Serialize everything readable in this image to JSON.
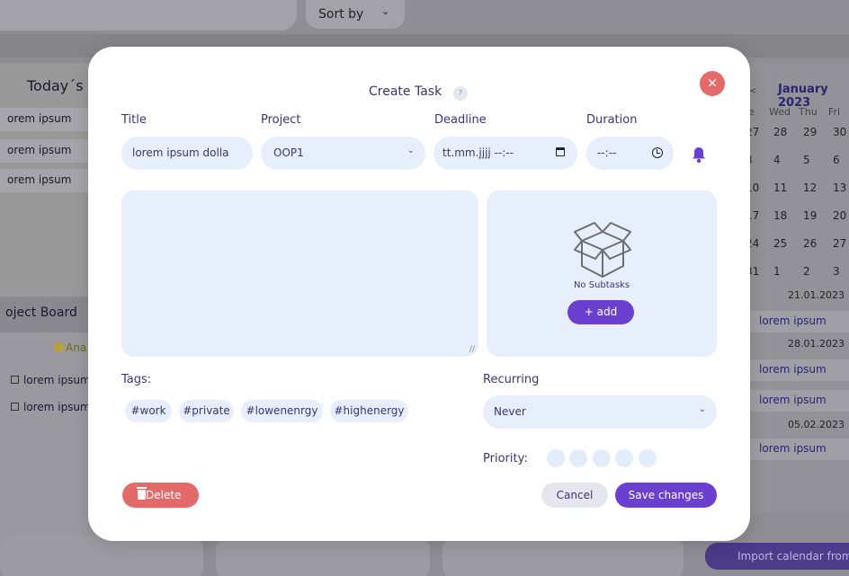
{
  "background": {
    "sort_label": "Sort by",
    "sort_chevron": "⌄",
    "todays_tasks_title": "Today´s ta",
    "todays_rows": [
      "orem ipsum",
      "orem ipsum",
      "orem ipsum"
    ],
    "project_board_title": "oject Board",
    "ana_label": "Ana",
    "project_items": [
      "lorem ipsum",
      "lorem ipsum"
    ],
    "calendar": {
      "month_title": "January 2023",
      "prev_marker": "<",
      "weekday_headers": [
        "e",
        "Wed",
        "Thu",
        "Fri"
      ],
      "weeks": [
        [
          "27",
          "28",
          "29",
          "30"
        ],
        [
          "3",
          "4",
          "5",
          "6"
        ],
        [
          "10",
          "11",
          "12",
          "13"
        ],
        [
          "17",
          "18",
          "19",
          "20"
        ],
        [
          "24",
          "25",
          "26",
          "27"
        ],
        [
          "31",
          "1",
          "2",
          "3"
        ]
      ],
      "agenda": [
        {
          "type": "date",
          "text": "21.01.2023"
        },
        {
          "type": "event",
          "marker": "9",
          "text": "lorem ipsum"
        },
        {
          "type": "date",
          "text": "28.01.2023"
        },
        {
          "type": "event",
          "marker": "1",
          "text": "lorem ipsum"
        },
        {
          "type": "event",
          "marker": "1",
          "text": "lorem ipsum"
        },
        {
          "type": "date",
          "text": "05.02.2023"
        },
        {
          "type": "event",
          "marker": "9",
          "text": "lorem ipsum"
        }
      ]
    },
    "import_button": "Import calendar from"
  },
  "modal": {
    "title": "Create Task",
    "help_icon": "?",
    "close_icon": "×",
    "labels": {
      "title": "Title",
      "project": "Project",
      "deadline": "Deadline",
      "duration": "Duration",
      "tags": "Tags:",
      "recurring": "Recurring",
      "priority": "Priority:"
    },
    "title_value": "lorem ipsum dolla",
    "project_value": "OOP1",
    "deadline_placeholder": "tt.mm.jjjj --:--",
    "duration_placeholder": "--:--",
    "description_value": "",
    "subtasks": {
      "empty_text": "No Subtasks",
      "add_label": "+ add"
    },
    "tags": [
      "#work",
      "#private",
      "#lowenenrgy",
      "#highenergy"
    ],
    "recurring_value": "Never",
    "priority_level": 0,
    "priority_max": 5,
    "buttons": {
      "delete": "Delete",
      "cancel": "Cancel",
      "save": "Save changes"
    },
    "colors": {
      "accent": "#6b3fd0",
      "danger": "#e46a6a",
      "field_bg": "#e7effc",
      "text": "#3b3670"
    }
  }
}
